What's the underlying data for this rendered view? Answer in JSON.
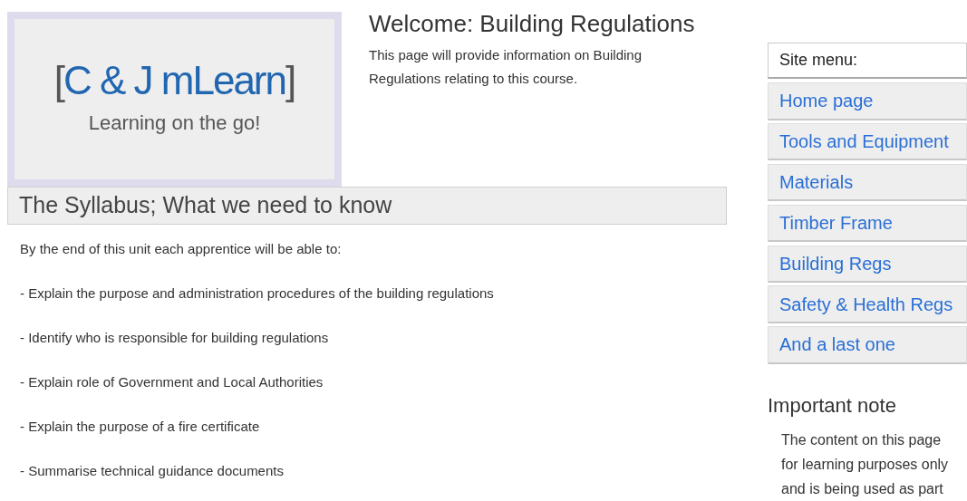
{
  "logo": {
    "title": "C & J mLearn",
    "left_bracket": "[",
    "right_bracket": "]",
    "tagline": "Learning on the go!"
  },
  "welcome": {
    "title": "Welcome: Building Regulations",
    "text": "This page will provide information on Building Regulations relating to this course."
  },
  "syllabus": {
    "title": "The Syllabus; What we need to know",
    "intro": "By the end of this unit each apprentice will be able to:",
    "items": [
      "- Explain the purpose and administration procedures of the building regulations",
      "- Identify who is responsible for building regulations",
      "- Explain role of Government and Local Authorities",
      "- Explain the purpose of a fire certificate",
      "- Summarise technical guidance documents"
    ]
  },
  "site_menu": {
    "title": "Site menu:",
    "items": [
      "Home page",
      "Tools and Equipment",
      "Materials",
      "Timber Frame",
      "Building Regs",
      "Safety & Health Regs",
      "And a last one"
    ]
  },
  "note": {
    "title": "Important note",
    "lines": [
      "The content on this page",
      "for learning purposes only",
      "and is being used as part"
    ]
  }
}
